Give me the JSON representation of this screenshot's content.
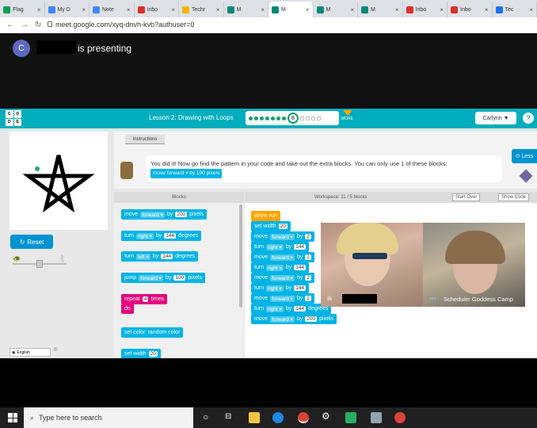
{
  "browser": {
    "tabs": [
      {
        "label": "Flag",
        "color": "#0f9d58",
        "active": false
      },
      {
        "label": "My D",
        "color": "#4285f4",
        "active": false
      },
      {
        "label": "Note",
        "color": "#4285f4",
        "active": false
      },
      {
        "label": "Inbo",
        "color": "#d93025",
        "active": false
      },
      {
        "label": "Techr",
        "color": "#f4b400",
        "active": false
      },
      {
        "label": "M",
        "color": "#00897b",
        "active": false
      },
      {
        "label": "M",
        "color": "#00897b",
        "active": true
      },
      {
        "label": "M",
        "color": "#00897b",
        "active": false
      },
      {
        "label": "M",
        "color": "#00897b",
        "active": false
      },
      {
        "label": "Inbo",
        "color": "#d93025",
        "active": false
      },
      {
        "label": "Inbo",
        "color": "#d93025",
        "active": false
      },
      {
        "label": "Tec",
        "color": "#1a73e8",
        "active": false
      }
    ],
    "url": "meet.google.com/xyq-dnvh-kvb?authuser=0"
  },
  "meet": {
    "avatar_letter": "C",
    "presenting_text": "is presenting"
  },
  "codeorg": {
    "lesson_title": "Lesson 2: Drawing with Loops",
    "current_level": "8",
    "more_label": "MORE",
    "user_name": "Carlynn",
    "help_icon": "?",
    "instructions_tab": "Instructions",
    "instruction_text": "You did it! Now go find the pattern in your code and take out the extra blocks. You can only use 1 of these blocks:",
    "instruction_block": "move forward ▾ by 100 pixels",
    "less_button": "Less",
    "reset_label": "Reset",
    "language": "English",
    "copyright": "©",
    "blocks_header": "Blocks",
    "workspace_header": "Workspace: 11 / 5 blocks",
    "start_over": "Start Over",
    "show_code": "Show Code",
    "toolbox_blocks": [
      {
        "verb": "move",
        "dir": "forward ▾",
        "by": "by",
        "val": "200",
        "unit": "pixels",
        "color": "blue"
      },
      {
        "verb": "turn",
        "dir": "right ▾",
        "by": "by",
        "val": "144",
        "unit": "degrees",
        "color": "blue"
      },
      {
        "verb": "turn",
        "dir": "left ▾",
        "by": "by",
        "val": "144",
        "unit": "degrees",
        "color": "blue"
      },
      {
        "verb": "jump",
        "dir": "forward ▾",
        "by": "by",
        "val": "100",
        "unit": "pixels",
        "color": "blue"
      },
      {
        "verb": "repeat",
        "dir": "",
        "by": "",
        "val": "4",
        "unit": "times",
        "color": "pink"
      },
      {
        "verb": "do",
        "dir": "",
        "by": "",
        "val": "",
        "unit": "",
        "color": "pink"
      },
      {
        "verb": "set color",
        "dir": "",
        "by": "",
        "val": "",
        "unit": "random color",
        "color": "blue"
      },
      {
        "verb": "set width",
        "dir": "",
        "by": "",
        "val": "20",
        "unit": "",
        "color": "blue"
      }
    ],
    "workspace_blocks": [
      {
        "text": "when run",
        "color": "orange"
      },
      {
        "text": "set width",
        "val": "20",
        "color": "blue"
      },
      {
        "text": "move",
        "dir": "forward ▾",
        "by": "by",
        "val": "2",
        "color": "blue"
      },
      {
        "text": "turn",
        "dir": "right ▾",
        "by": "by",
        "val": "144",
        "color": "blue"
      },
      {
        "text": "move",
        "dir": "forward ▾",
        "by": "by",
        "val": "2",
        "color": "blue"
      },
      {
        "text": "turn",
        "dir": "right ▾",
        "by": "by",
        "val": "144",
        "color": "blue"
      },
      {
        "text": "move",
        "dir": "forward ▾",
        "by": "by",
        "val": "2",
        "color": "blue"
      },
      {
        "text": "turn",
        "dir": "right ▾",
        "by": "by",
        "val": "144",
        "color": "blue"
      },
      {
        "text": "move",
        "dir": "forward ▾",
        "by": "by",
        "val": "2",
        "color": "blue"
      },
      {
        "text": "turn",
        "dir": "right ▾",
        "by": "by",
        "val": "144",
        "unit": "degrees",
        "color": "blue"
      },
      {
        "text": "move",
        "dir": "forward ▾",
        "by": "by",
        "val": "200",
        "unit": "pixels",
        "color": "blue"
      }
    ]
  },
  "video": {
    "participant_name": "Scheduler Goddess Camp"
  },
  "taskbar": {
    "search_placeholder": "Type here to search"
  }
}
